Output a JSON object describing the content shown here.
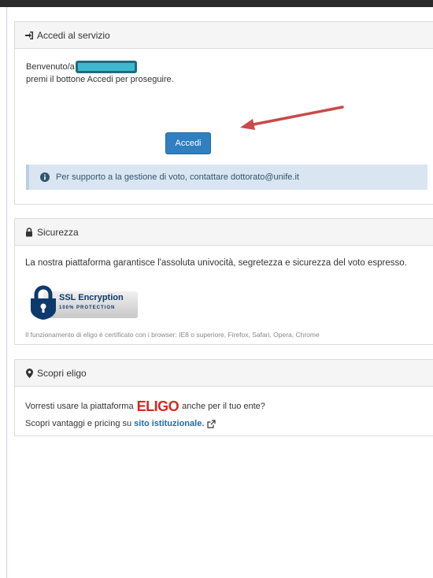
{
  "login_panel": {
    "title": "Accedi al servizio",
    "welcome_prefix": "Benvenuto/a",
    "instruction": "premi il bottone Accedi per proseguire.",
    "button_label": "Accedi",
    "support_text": "Per supporto a la gestione di voto, contattare dottorato@unife.it"
  },
  "security_panel": {
    "title": "Sicurezza",
    "text": "La nostra piattaforma garantisce l'assoluta univocità, segretezza e sicurezza del voto espresso.",
    "ssl_title": "SSL Encryption",
    "ssl_subtitle": "100% PROTECTION",
    "footnote": "Il funzionamento di eligo è certificato con i browser: IE8 o superiore, Firefox, Safari, Opera, Chrome"
  },
  "discover_panel": {
    "title": "Scopri eligo",
    "line1_prefix": "Vorresti usare la piattaforma",
    "logo_text": "ELIGO",
    "line1_suffix": "anche per il tuo ente?",
    "line2_prefix": "Scopri vantaggi e pricing su",
    "link_text": "sito istituzionale."
  },
  "colors": {
    "primary_button": "#2f7fc1",
    "info_background": "#d9e6f2",
    "logo_red": "#d22a1e",
    "redaction": "#3fb8cf",
    "arrow": "#c94a4a"
  },
  "icons": [
    "sign-in-icon",
    "info-circle-icon",
    "lock-icon",
    "map-marker-icon",
    "external-link-icon",
    "ssl-padlock-icon"
  ]
}
